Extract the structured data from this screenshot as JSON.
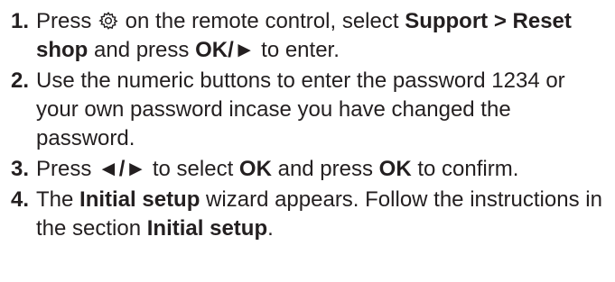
{
  "steps": [
    {
      "number": "1.",
      "parts": {
        "a": "Press ",
        "icon": "gear-icon",
        "b": " on the remote control, select ",
        "c": "Support >",
        "d": "Reset shop",
        "e": " and press ",
        "f": "OK/►",
        "g": " to enter."
      }
    },
    {
      "number": "2.",
      "parts": {
        "a": "Use the numeric buttons to enter the password 1234 or your own password incase you have changed the password."
      }
    },
    {
      "number": "3.",
      "parts": {
        "a": "Press ",
        "b": "◄/►",
        "c": " to select ",
        "d": "OK",
        "e": " and press ",
        "f": "OK",
        "g": " to confirm."
      }
    },
    {
      "number": "4.",
      "parts": {
        "a": "The ",
        "b": "Initial setup",
        "c": " wizard appears. Follow the instructions in the section ",
        "d": "Initial setup",
        "e": "."
      }
    }
  ]
}
